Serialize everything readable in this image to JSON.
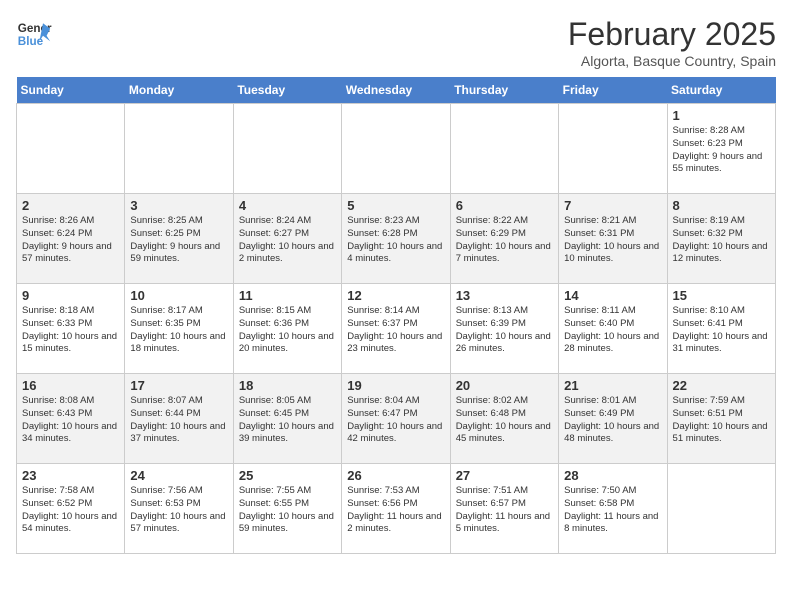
{
  "header": {
    "logo_line1": "General",
    "logo_line2": "Blue",
    "month_title": "February 2025",
    "location": "Algorta, Basque Country, Spain"
  },
  "weekdays": [
    "Sunday",
    "Monday",
    "Tuesday",
    "Wednesday",
    "Thursday",
    "Friday",
    "Saturday"
  ],
  "weeks": [
    [
      {
        "day": "",
        "content": ""
      },
      {
        "day": "",
        "content": ""
      },
      {
        "day": "",
        "content": ""
      },
      {
        "day": "",
        "content": ""
      },
      {
        "day": "",
        "content": ""
      },
      {
        "day": "",
        "content": ""
      },
      {
        "day": "1",
        "content": "Sunrise: 8:28 AM\nSunset: 6:23 PM\nDaylight: 9 hours and 55 minutes."
      }
    ],
    [
      {
        "day": "2",
        "content": "Sunrise: 8:26 AM\nSunset: 6:24 PM\nDaylight: 9 hours and 57 minutes."
      },
      {
        "day": "3",
        "content": "Sunrise: 8:25 AM\nSunset: 6:25 PM\nDaylight: 9 hours and 59 minutes."
      },
      {
        "day": "4",
        "content": "Sunrise: 8:24 AM\nSunset: 6:27 PM\nDaylight: 10 hours and 2 minutes."
      },
      {
        "day": "5",
        "content": "Sunrise: 8:23 AM\nSunset: 6:28 PM\nDaylight: 10 hours and 4 minutes."
      },
      {
        "day": "6",
        "content": "Sunrise: 8:22 AM\nSunset: 6:29 PM\nDaylight: 10 hours and 7 minutes."
      },
      {
        "day": "7",
        "content": "Sunrise: 8:21 AM\nSunset: 6:31 PM\nDaylight: 10 hours and 10 minutes."
      },
      {
        "day": "8",
        "content": "Sunrise: 8:19 AM\nSunset: 6:32 PM\nDaylight: 10 hours and 12 minutes."
      }
    ],
    [
      {
        "day": "9",
        "content": "Sunrise: 8:18 AM\nSunset: 6:33 PM\nDaylight: 10 hours and 15 minutes."
      },
      {
        "day": "10",
        "content": "Sunrise: 8:17 AM\nSunset: 6:35 PM\nDaylight: 10 hours and 18 minutes."
      },
      {
        "day": "11",
        "content": "Sunrise: 8:15 AM\nSunset: 6:36 PM\nDaylight: 10 hours and 20 minutes."
      },
      {
        "day": "12",
        "content": "Sunrise: 8:14 AM\nSunset: 6:37 PM\nDaylight: 10 hours and 23 minutes."
      },
      {
        "day": "13",
        "content": "Sunrise: 8:13 AM\nSunset: 6:39 PM\nDaylight: 10 hours and 26 minutes."
      },
      {
        "day": "14",
        "content": "Sunrise: 8:11 AM\nSunset: 6:40 PM\nDaylight: 10 hours and 28 minutes."
      },
      {
        "day": "15",
        "content": "Sunrise: 8:10 AM\nSunset: 6:41 PM\nDaylight: 10 hours and 31 minutes."
      }
    ],
    [
      {
        "day": "16",
        "content": "Sunrise: 8:08 AM\nSunset: 6:43 PM\nDaylight: 10 hours and 34 minutes."
      },
      {
        "day": "17",
        "content": "Sunrise: 8:07 AM\nSunset: 6:44 PM\nDaylight: 10 hours and 37 minutes."
      },
      {
        "day": "18",
        "content": "Sunrise: 8:05 AM\nSunset: 6:45 PM\nDaylight: 10 hours and 39 minutes."
      },
      {
        "day": "19",
        "content": "Sunrise: 8:04 AM\nSunset: 6:47 PM\nDaylight: 10 hours and 42 minutes."
      },
      {
        "day": "20",
        "content": "Sunrise: 8:02 AM\nSunset: 6:48 PM\nDaylight: 10 hours and 45 minutes."
      },
      {
        "day": "21",
        "content": "Sunrise: 8:01 AM\nSunset: 6:49 PM\nDaylight: 10 hours and 48 minutes."
      },
      {
        "day": "22",
        "content": "Sunrise: 7:59 AM\nSunset: 6:51 PM\nDaylight: 10 hours and 51 minutes."
      }
    ],
    [
      {
        "day": "23",
        "content": "Sunrise: 7:58 AM\nSunset: 6:52 PM\nDaylight: 10 hours and 54 minutes."
      },
      {
        "day": "24",
        "content": "Sunrise: 7:56 AM\nSunset: 6:53 PM\nDaylight: 10 hours and 57 minutes."
      },
      {
        "day": "25",
        "content": "Sunrise: 7:55 AM\nSunset: 6:55 PM\nDaylight: 10 hours and 59 minutes."
      },
      {
        "day": "26",
        "content": "Sunrise: 7:53 AM\nSunset: 6:56 PM\nDaylight: 11 hours and 2 minutes."
      },
      {
        "day": "27",
        "content": "Sunrise: 7:51 AM\nSunset: 6:57 PM\nDaylight: 11 hours and 5 minutes."
      },
      {
        "day": "28",
        "content": "Sunrise: 7:50 AM\nSunset: 6:58 PM\nDaylight: 11 hours and 8 minutes."
      },
      {
        "day": "",
        "content": ""
      }
    ]
  ]
}
